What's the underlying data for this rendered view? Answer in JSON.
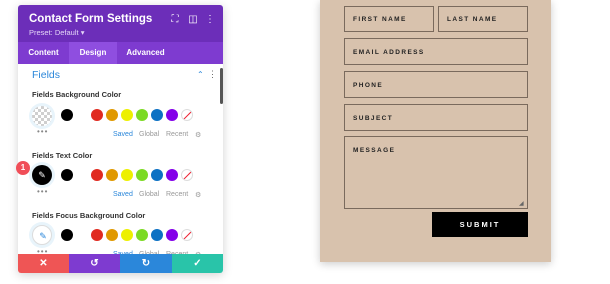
{
  "panel": {
    "title": "Contact Form Settings",
    "preset": "Preset: Default ▾",
    "tabs": [
      "Content",
      "Design",
      "Advanced"
    ],
    "active_tab": "Design",
    "section_title": "Fields",
    "groups": [
      {
        "label": "Fields Background Color",
        "picker": "checker"
      },
      {
        "label": "Fields Text Color",
        "picker": "black"
      },
      {
        "label": "Fields Focus Background Color",
        "picker": "white"
      }
    ],
    "swatch_colors": [
      "#000000",
      "#ffffff",
      "#e02b20",
      "#e09900",
      "#edf000",
      "#7cda24",
      "#0c71c3",
      "#8300e9"
    ],
    "color_tabs": [
      "Saved",
      "Global",
      "Recent"
    ],
    "badge": "1",
    "footer": {
      "cancel": "✕",
      "undo": "↺",
      "redo": "↻",
      "save": "✓",
      "colors": [
        "#ef5555",
        "#7e3bd0",
        "#2b87da",
        "#29c4a9"
      ]
    }
  },
  "form": {
    "first_name": "FIRST NAME",
    "last_name": "LAST NAME",
    "email": "EMAIL ADDRESS",
    "phone": "PHONE",
    "subject": "SUBJECT",
    "message": "MESSAGE",
    "submit": "SUBMIT",
    "background": "#d8c2ad"
  }
}
